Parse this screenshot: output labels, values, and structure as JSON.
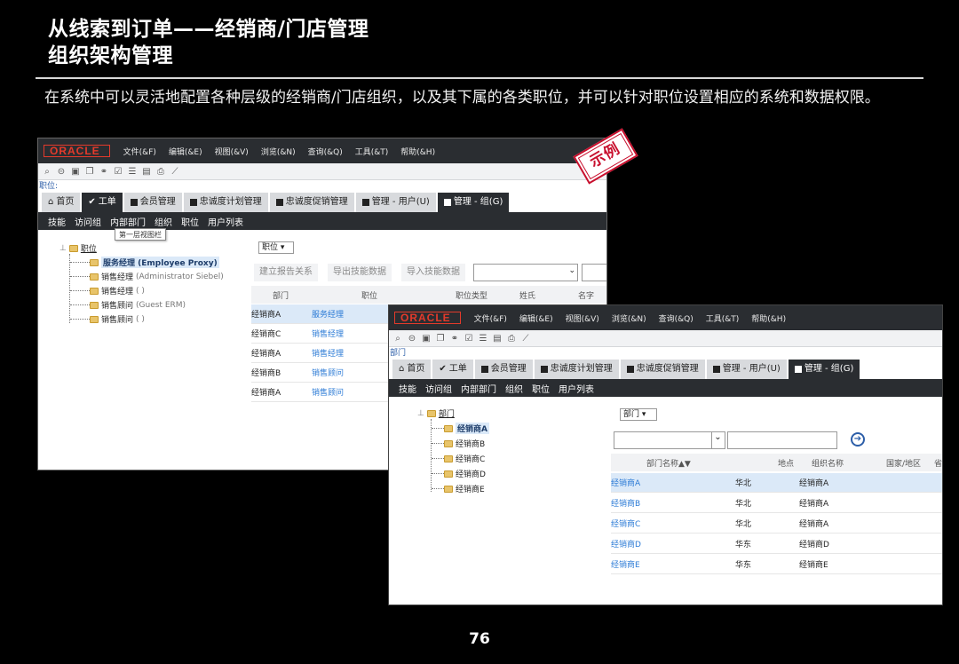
{
  "slide": {
    "title_line1": "从线索到订单——经销商/门店管理",
    "title_line2": "组织架构管理",
    "description": "在系统中可以灵活地配置各种层级的经销商/门店组织，以及其下属的各类职位，并可以针对职位设置相应的系统和数据权限。",
    "page_number": "76",
    "stamp": "示例"
  },
  "menu": {
    "logo": "ORACLE",
    "items": [
      "文件(&F)",
      "编辑(&E)",
      "视图(&V)",
      "浏览(&N)",
      "查询(&Q)",
      "工具(&T)",
      "帮助(&H)"
    ]
  },
  "window1": {
    "breadcrumb": "职位:",
    "tabs": [
      "首页",
      "工单",
      "会员管理",
      "忠诚度计划管理",
      "忠诚度促销管理",
      "管理 - 用户(U)",
      "管理 - 组(G)"
    ],
    "subtabs": [
      "技能",
      "访问组",
      "内部部门",
      "组织",
      "职位",
      "用户列表"
    ],
    "tooltip": "第一层视图栏",
    "tree": {
      "root": "职位",
      "children": [
        {
          "name": "服务经理",
          "detail": "(Employee Proxy)"
        },
        {
          "name": "销售经理",
          "detail": "(Administrator Siebel)"
        },
        {
          "name": "销售经理",
          "detail": "( )"
        },
        {
          "name": "销售顾问",
          "detail": "(Guest ERM)"
        },
        {
          "name": "销售顾问",
          "detail": "( )"
        }
      ]
    },
    "view_select": "职位",
    "buttons": [
      "建立报告关系",
      "导出技能数据",
      "导入技能数据"
    ],
    "columns": [
      "部门",
      "职位",
      "职位类型",
      "姓氏",
      "名字"
    ],
    "rows": [
      [
        "经销商A",
        "服务经理"
      ],
      [
        "经销商C",
        "销售经理"
      ],
      [
        "经销商A",
        "销售经理"
      ],
      [
        "经销商B",
        "销售顾问"
      ],
      [
        "经销商A",
        "销售顾问"
      ]
    ]
  },
  "window2": {
    "breadcrumb": "部门",
    "tabs": [
      "首页",
      "工单",
      "会员管理",
      "忠诚度计划管理",
      "忠诚度促销管理",
      "管理 - 用户(U)",
      "管理 - 组(G)"
    ],
    "subtabs": [
      "技能",
      "访问组",
      "内部部门",
      "组织",
      "职位",
      "用户列表"
    ],
    "tree": {
      "root": "部门",
      "children": [
        "经销商A",
        "经销商B",
        "经销商C",
        "经销商D",
        "经销商E"
      ]
    },
    "view_select": "部门",
    "columns": [
      "部门名称",
      "地点",
      "组织名称",
      "国家/地区",
      "省"
    ],
    "rows": [
      [
        "经销商A",
        "华北",
        "经销商A"
      ],
      [
        "经销商B",
        "华北",
        "经销商A"
      ],
      [
        "经销商C",
        "华北",
        "经销商A"
      ],
      [
        "经销商D",
        "华东",
        "经销商D"
      ],
      [
        "经销商E",
        "华东",
        "经销商E"
      ]
    ]
  }
}
